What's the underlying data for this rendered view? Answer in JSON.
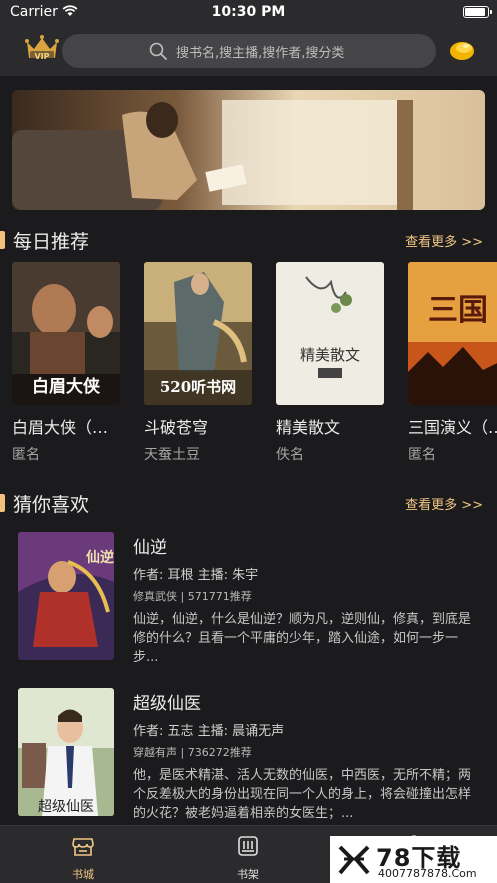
{
  "status_bar": {
    "carrier": "Carrier",
    "time": "10:30 PM"
  },
  "top_nav": {
    "vip_label": "VIP",
    "search_placeholder": "搜书名,搜主播,搜作者,搜分类"
  },
  "daily": {
    "title": "每日推荐",
    "more": "查看更多 >>",
    "books": [
      {
        "title": "白眉大侠（…",
        "author": "匿名",
        "cover_text": "白眉大侠"
      },
      {
        "title": "斗破苍穹",
        "author": "天蚕土豆",
        "cover_text": "520听书网"
      },
      {
        "title": "精美散文",
        "author": "佚名",
        "cover_text": "精美散文"
      },
      {
        "title": "三国演义（…",
        "author": "匿名",
        "cover_text": "三国"
      }
    ]
  },
  "guess": {
    "title": "猜你喜欢",
    "more": "查看更多 >>",
    "items": [
      {
        "title": "仙逆",
        "author_line": "作者: 耳根   主播: 朱宇",
        "meta": "修真武侠 | 571771推荐",
        "desc": "仙逆，仙逆，什么是仙逆？顺为凡，逆则仙，修真，到底是修的什么？且看一个平庸的少年，踏入仙途，如何一步一步...",
        "cover_text": "仙逆"
      },
      {
        "title": "超级仙医",
        "author_line": "作者: 五志   主播: 晨诵无声",
        "meta": "穿越有声 | 736272推荐",
        "desc": "他，是医术精湛、活人无数的仙医，中西医，无所不精；两个反差极大的身份出现在同一个人的身上，将会碰撞出怎样的火花？被老妈逼着相亲的女医生；...",
        "cover_text": "超级仙医"
      }
    ]
  },
  "tabbar": {
    "tabs": [
      {
        "label": "书城",
        "active": true
      },
      {
        "label": "书架",
        "active": false
      }
    ]
  },
  "watermark": {
    "big": "78下载",
    "small": "4007787878.Com"
  },
  "colors": {
    "accent": "#f2c785",
    "background": "#1b1b1d",
    "bar": "#2b2b2d"
  }
}
